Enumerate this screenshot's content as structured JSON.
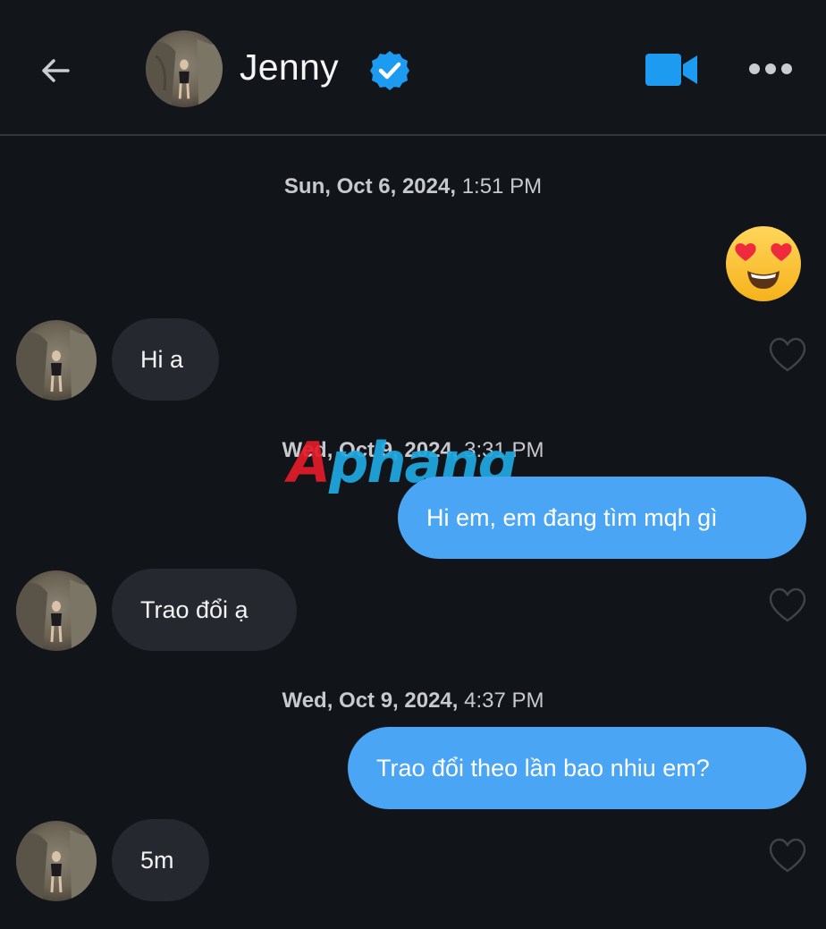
{
  "header": {
    "back_icon": "arrow-left-icon",
    "name": "Jenny",
    "verified_icon": "verified-badge-icon",
    "video_icon": "video-camera-icon",
    "more_icon": "more-horizontal-icon"
  },
  "colors": {
    "background": "#111419",
    "incoming_bubble": "#25282e",
    "outgoing_bubble": "#4aa6f4",
    "accent": "#1d9bf0"
  },
  "watermark": {
    "part1": "A",
    "part2": "phang"
  },
  "messages": [
    {
      "type": "timestamp",
      "date": "Sun, Oct 6, 2024,",
      "time": "1:51 PM"
    },
    {
      "type": "outgoing",
      "content": "heart-eyes-emoji"
    },
    {
      "type": "incoming",
      "text": "Hi a"
    },
    {
      "type": "timestamp",
      "date": "Wed, Oct 9, 2024,",
      "time": "3:31 PM"
    },
    {
      "type": "outgoing",
      "text": "Hi em, em đang tìm mqh gì"
    },
    {
      "type": "incoming",
      "text": "Trao đổi ạ"
    },
    {
      "type": "timestamp",
      "date": "Wed, Oct 9, 2024,",
      "time": "4:37 PM"
    },
    {
      "type": "outgoing",
      "text": "Trao đổi theo lần bao nhiu em?"
    },
    {
      "type": "incoming",
      "text": "5m"
    }
  ]
}
